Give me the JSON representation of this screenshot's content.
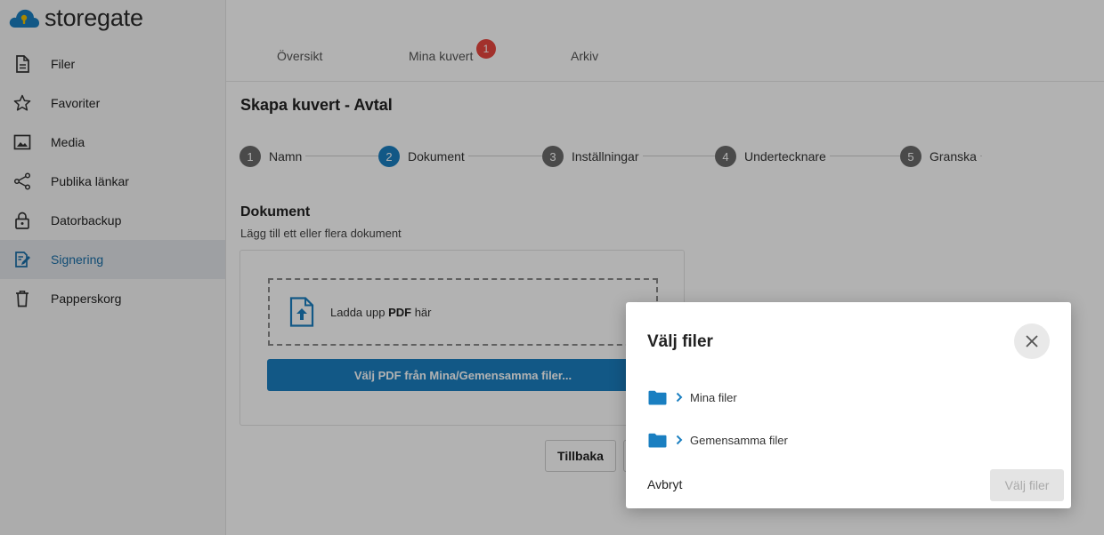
{
  "app": {
    "logo_text": "storegate"
  },
  "sidebar": {
    "items": [
      {
        "label": "Filer",
        "icon": "document-icon"
      },
      {
        "label": "Favoriter",
        "icon": "star-icon"
      },
      {
        "label": "Media",
        "icon": "image-icon"
      },
      {
        "label": "Publika länkar",
        "icon": "share-icon"
      },
      {
        "label": "Datorbackup",
        "icon": "lock-icon"
      },
      {
        "label": "Signering",
        "icon": "signing-icon",
        "active": true
      },
      {
        "label": "Papperskorg",
        "icon": "trash-icon"
      }
    ]
  },
  "tabs": {
    "items": [
      {
        "label": "Översikt"
      },
      {
        "label": "Mina kuvert"
      },
      {
        "label": "Arkiv"
      }
    ],
    "badge": "1"
  },
  "page": {
    "title": "Skapa kuvert - Avtal",
    "steps": [
      {
        "num": "1",
        "label": "Namn"
      },
      {
        "num": "2",
        "label": "Dokument",
        "active": true
      },
      {
        "num": "3",
        "label": "Inställningar"
      },
      {
        "num": "4",
        "label": "Undertecknare"
      },
      {
        "num": "5",
        "label": "Granska"
      }
    ],
    "section_title": "Dokument",
    "section_subtitle": "Lägg till ett eller flera dokument",
    "upload": {
      "text_before": "Ladda upp ",
      "text_bold": "PDF",
      "text_after": " här",
      "pick_button": "Välj PDF från Mina/Gemensamma filer..."
    },
    "back_button": "Tillbaka"
  },
  "modal": {
    "title": "Välj filer",
    "folders": [
      {
        "label": "Mina filer"
      },
      {
        "label": "Gemensamma filer"
      }
    ],
    "cancel": "Avbryt",
    "confirm": "Välj filer"
  },
  "colors": {
    "accent": "#1a7fc1",
    "badge": "#e8473f",
    "step_inactive": "#6b6b6b",
    "folder": "#1a7fc1"
  }
}
